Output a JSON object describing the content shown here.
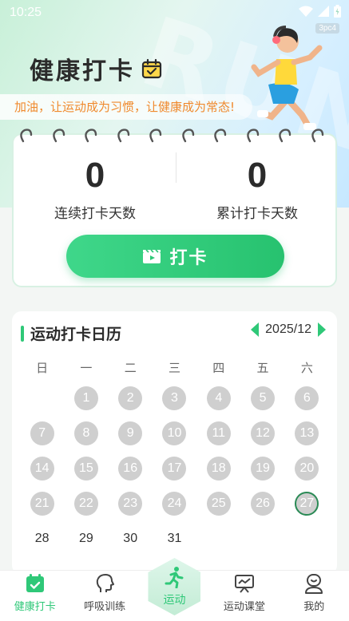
{
  "status_bar": {
    "time": "10:25",
    "badge": "3pc4"
  },
  "header": {
    "title": "健康打卡",
    "motto": "加油，让运动成为习惯，让健康成为常态!"
  },
  "stats": {
    "consecutive": {
      "value": "0",
      "label": "连续打卡天数"
    },
    "total": {
      "value": "0",
      "label": "累计打卡天数"
    },
    "checkin_label": "打卡"
  },
  "calendar": {
    "title": "运动打卡日历",
    "month": "2025/12",
    "weekdays": [
      "日",
      "一",
      "二",
      "三",
      "四",
      "五",
      "六"
    ],
    "days": [
      "",
      "1",
      "2",
      "3",
      "4",
      "5",
      "6",
      "7",
      "8",
      "9",
      "10",
      "11",
      "12",
      "13",
      "14",
      "15",
      "16",
      "17",
      "18",
      "19",
      "20",
      "21",
      "22",
      "23",
      "24",
      "25",
      "26",
      "27",
      "28",
      "29",
      "30",
      "31"
    ],
    "today": 27,
    "accent_color": "#2fc878",
    "past_day_color": "#cfcfcf"
  },
  "nav": {
    "items": [
      {
        "label": "健康打卡",
        "icon": "calendar-check-icon",
        "active": true
      },
      {
        "label": "呼吸训练",
        "icon": "head-profile-icon",
        "active": false
      },
      {
        "label": "运动",
        "icon": "running-icon",
        "active": false
      },
      {
        "label": "运动课堂",
        "icon": "presentation-board-icon",
        "active": false
      },
      {
        "label": "我的",
        "icon": "user-face-icon",
        "active": false
      }
    ]
  }
}
